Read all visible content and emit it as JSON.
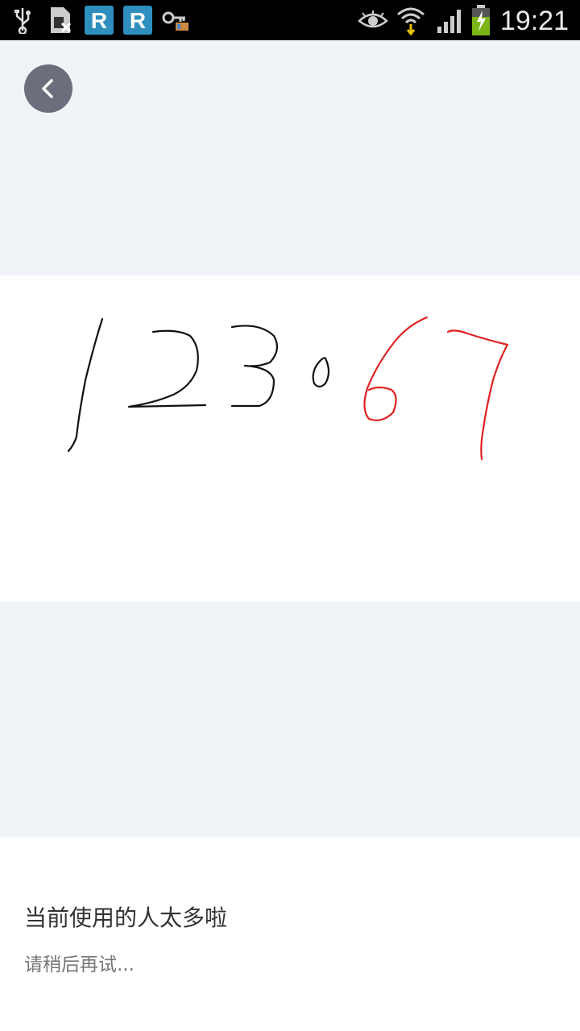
{
  "status_bar": {
    "time": "19:21",
    "icons": [
      "usb-icon",
      "sim-card-icon",
      "app-r-icon",
      "app-r-icon",
      "keys-icon",
      "eye-icon",
      "wifi-icon",
      "signal-icon",
      "battery-charging-icon"
    ]
  },
  "colors": {
    "page_background": "#f0f4f8",
    "ink_black": "#111111",
    "ink_red": "#e02020",
    "back_button": "#6b6f7c"
  },
  "canvas": {
    "strokes_description": "handwritten digits 1 2 3 0 in black and 6 7 in red"
  },
  "message": {
    "title": "当前使用的人太多啦",
    "subtitle": "请稍后再试..."
  }
}
